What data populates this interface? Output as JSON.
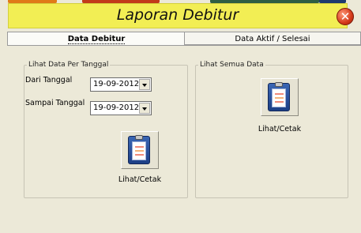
{
  "window": {
    "title": "Laporan Debitur"
  },
  "tabs": [
    {
      "label": "Data Debitur",
      "active": true
    },
    {
      "label": "Data Aktif / Selesai",
      "active": false
    }
  ],
  "group_by_date": {
    "legend": "Lihat Data Per Tanggal",
    "from_label": "Dari Tanggal",
    "from_value": "19-09-2012",
    "to_label": "Sampai Tanggal",
    "to_value": "19-09-2012",
    "button_label": "Lihat/Cetak"
  },
  "group_all": {
    "legend": "Lihat Semua Data",
    "button_label": "Lihat/Cetak"
  },
  "colors": {
    "title_bar": "#f2ee54",
    "window_bg": "#ece9d8",
    "top_segments": [
      "#e07a18",
      "#c23a1a",
      "#2f5e43",
      "#1e3a6e"
    ]
  },
  "icons": {
    "close": "close-icon",
    "print": "clipboard-icon",
    "dropdown": "chevron-down-icon"
  }
}
